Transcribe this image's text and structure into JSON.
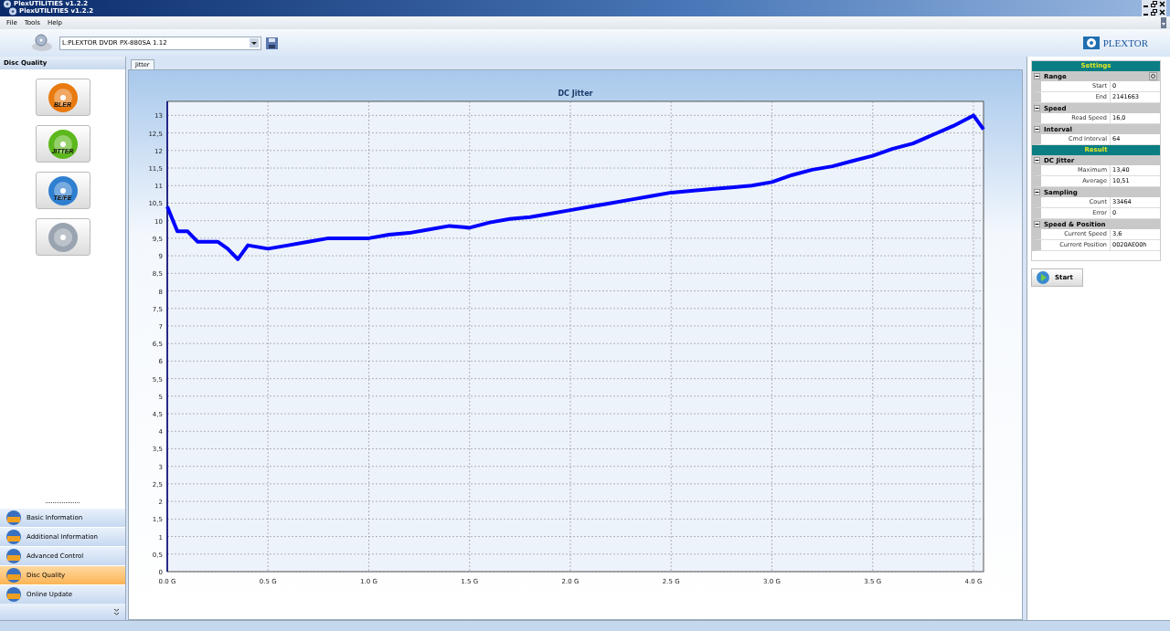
{
  "window": {
    "titles": [
      "PlexUTILITIES v1.2.2",
      "PlexUTILITIES v1.2.2"
    ]
  },
  "menu": [
    "File",
    "Tools",
    "Help"
  ],
  "drive": {
    "value": "L:PLEXTOR DVDR  PX-880SA  1.12"
  },
  "logo": "PLEXTOR",
  "left_panel": {
    "title": "Disc Quality",
    "tools": [
      {
        "label": "BLER",
        "color": "#e87a10"
      },
      {
        "label": "JITTER",
        "color": "#5cb81c"
      },
      {
        "label": "TE/FE",
        "color": "#2f7fd0"
      },
      {
        "color": "#9aa4b0"
      }
    ],
    "nav": [
      {
        "label": "Basic Information",
        "selected": false
      },
      {
        "label": "Additional Information",
        "selected": false
      },
      {
        "label": "Advanced Control",
        "selected": false
      },
      {
        "label": "Disc Quality",
        "selected": true
      },
      {
        "label": "Online Update",
        "selected": false
      }
    ]
  },
  "tabs": [
    {
      "label": "Jitter",
      "selected": true
    }
  ],
  "chart_data": {
    "type": "line",
    "title": "DC Jitter",
    "grid": true,
    "xlim": [
      0,
      4.05
    ],
    "ylim": [
      0,
      13.4
    ],
    "x": [
      0,
      0.05,
      0.1,
      0.15,
      0.2,
      0.25,
      0.3,
      0.35,
      0.4,
      0.5,
      0.6,
      0.7,
      0.8,
      0.9,
      1.0,
      1.1,
      1.2,
      1.3,
      1.4,
      1.5,
      1.6,
      1.7,
      1.8,
      1.9,
      2.0,
      2.1,
      2.2,
      2.3,
      2.4,
      2.5,
      2.6,
      2.7,
      2.8,
      2.9,
      3.0,
      3.1,
      3.2,
      3.3,
      3.4,
      3.5,
      3.6,
      3.7,
      3.8,
      3.9,
      4.0,
      4.05
    ],
    "series": [
      {
        "color": "#0000ff",
        "values": [
          10.4,
          9.7,
          9.7,
          9.4,
          9.4,
          9.4,
          9.2,
          8.9,
          9.3,
          9.2,
          9.3,
          9.4,
          9.5,
          9.5,
          9.5,
          9.6,
          9.65,
          9.75,
          9.85,
          9.8,
          9.95,
          10.05,
          10.1,
          10.2,
          10.3,
          10.4,
          10.5,
          10.6,
          10.7,
          10.8,
          10.85,
          10.9,
          10.95,
          11.0,
          11.1,
          11.3,
          11.45,
          11.55,
          11.7,
          11.85,
          12.05,
          12.2,
          12.45,
          12.7,
          13.0,
          12.6
        ]
      }
    ],
    "xticks": [
      {
        "value": 0,
        "label": "0.0 G"
      },
      {
        "value": 0.5,
        "label": "0.5 G"
      },
      {
        "value": 1,
        "label": "1.0 G"
      },
      {
        "value": 1.5,
        "label": "1.5 G"
      },
      {
        "value": 2,
        "label": "2.0 G"
      },
      {
        "value": 2.5,
        "label": "2.5 G"
      },
      {
        "value": 3,
        "label": "3.0 G"
      },
      {
        "value": 3.5,
        "label": "3.5 G"
      },
      {
        "value": 4,
        "label": "4.0 G"
      }
    ],
    "yticks": [
      {
        "value": 0,
        "label": "0"
      },
      {
        "value": 0.5,
        "label": "0,5"
      },
      {
        "value": 1,
        "label": "1"
      },
      {
        "value": 1.5,
        "label": "1,5"
      },
      {
        "value": 2,
        "label": "2"
      },
      {
        "value": 2.5,
        "label": "2,5"
      },
      {
        "value": 3,
        "label": "3"
      },
      {
        "value": 3.5,
        "label": "3,5"
      },
      {
        "value": 4,
        "label": "4"
      },
      {
        "value": 4.5,
        "label": "4,5"
      },
      {
        "value": 5,
        "label": "5"
      },
      {
        "value": 5.5,
        "label": "5,5"
      },
      {
        "value": 6,
        "label": "6"
      },
      {
        "value": 6.5,
        "label": "6,5"
      },
      {
        "value": 7,
        "label": "7"
      },
      {
        "value": 7.5,
        "label": "7,5"
      },
      {
        "value": 8,
        "label": "8"
      },
      {
        "value": 8.5,
        "label": "8,5"
      },
      {
        "value": 9,
        "label": "9"
      },
      {
        "value": 9.5,
        "label": "9,5"
      },
      {
        "value": 10,
        "label": "10"
      },
      {
        "value": 10.5,
        "label": "10,5"
      },
      {
        "value": 11,
        "label": "11"
      },
      {
        "value": 11.5,
        "label": "11,5"
      },
      {
        "value": 12,
        "label": "12"
      },
      {
        "value": 12.5,
        "label": "12,5"
      },
      {
        "value": 13,
        "label": "13"
      }
    ]
  },
  "properties": [
    {
      "kind": "header",
      "label": "Settings"
    },
    {
      "kind": "group",
      "label": "Range",
      "rows": [
        {
          "name": "Start",
          "value": "0"
        },
        {
          "name": "End",
          "value": "2141663"
        }
      ]
    },
    {
      "kind": "group",
      "label": "Speed",
      "rows": [
        {
          "name": "Read Speed",
          "value": "16,0"
        }
      ]
    },
    {
      "kind": "group",
      "label": "Interval",
      "rows": [
        {
          "name": "Cmd Interval",
          "value": "64"
        }
      ]
    },
    {
      "kind": "header",
      "label": "Result"
    },
    {
      "kind": "group",
      "label": "DC Jitter",
      "rows": [
        {
          "name": "Maximum",
          "value": "13,40"
        },
        {
          "name": "Average",
          "value": "10,51"
        }
      ]
    },
    {
      "kind": "group",
      "label": "Sampling",
      "rows": [
        {
          "name": "Count",
          "value": "33464"
        },
        {
          "name": "Error",
          "value": "0"
        }
      ]
    },
    {
      "kind": "group",
      "label": "Speed & Position",
      "rows": [
        {
          "name": "Current Speed",
          "value": "3,6"
        },
        {
          "name": "Current Position",
          "value": "0020AE00h"
        }
      ]
    }
  ],
  "start_button": "Start"
}
